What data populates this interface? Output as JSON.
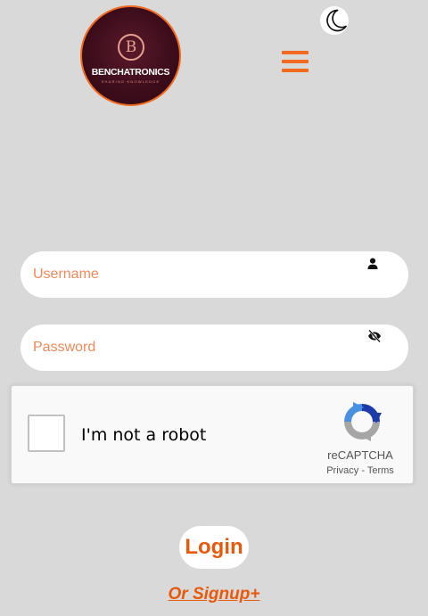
{
  "header": {
    "logo": {
      "initial": "B",
      "name": "BENCHATRONICS",
      "tagline": "SHARING KNOWLEDGE"
    },
    "theme_toggle_icon": "moon-icon",
    "menu_icon": "hamburger-icon"
  },
  "form": {
    "username": {
      "placeholder": "Username",
      "value": "",
      "icon": "person-icon"
    },
    "password": {
      "placeholder": "Password",
      "value": "",
      "icon": "eye-off-icon"
    },
    "captcha": {
      "label": "I'm not a robot",
      "brand": "reCAPTCHA",
      "privacy_label": "Privacy",
      "separator": "-",
      "terms_label": "Terms"
    },
    "login_label": "Login",
    "signup_label": "Or Signup+"
  },
  "colors": {
    "accent": "#f06a20",
    "background": "#d9d9d9",
    "logo_background": "#3e0d1c"
  }
}
